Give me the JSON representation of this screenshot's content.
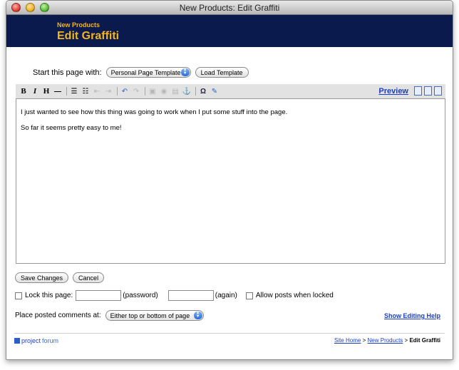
{
  "window": {
    "title": "New Products: Edit Graffiti"
  },
  "banner": {
    "subtitle": "New Products",
    "title": "Edit Graffiti"
  },
  "template": {
    "label": "Start this page with:",
    "selected": "Personal Page Template",
    "load_button": "Load Template"
  },
  "toolbar": {
    "bold": "B",
    "italic": "I",
    "heading": "H",
    "rule": "—",
    "omega": "Ω",
    "preview_label": "Preview"
  },
  "editor": {
    "lines": [
      "I just wanted to see how this thing was going to work when I put some stuff into the page.",
      "So far it seems pretty easy to me!"
    ]
  },
  "actions": {
    "save": "Save Changes",
    "cancel": "Cancel"
  },
  "lock": {
    "label": "Lock this page:",
    "password_hint": "(password)",
    "again_hint": "(again)",
    "allow_label": "Allow posts when locked"
  },
  "comments": {
    "label": "Place posted comments at:",
    "selected": "Either top or bottom of page",
    "help_link": "Show Editing Help"
  },
  "footer": {
    "logo_part1": "project",
    "logo_part2": "forum",
    "crumbs": [
      "Site Home",
      "New Products"
    ],
    "sep": ">",
    "current": "Edit Graffiti"
  }
}
